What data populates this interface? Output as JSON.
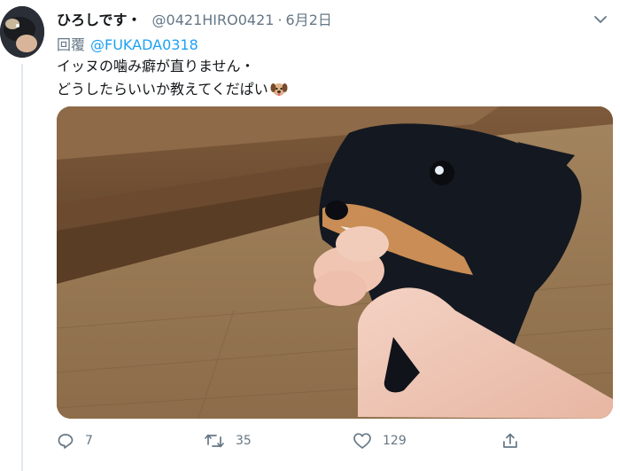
{
  "tweet": {
    "display_name": "ひろしです・",
    "handle": "@0421HIRO0421",
    "separator": "·",
    "date": "6月2日",
    "reply_prefix": "回覆",
    "reply_to": "@FUKADA0318",
    "text_line1": "イッヌの噛み癖が直りません・",
    "text_line2": "どうしたらいいか教えてくだぱい",
    "emoji": "dog-face-icon",
    "media_description_icon": "photo-dog-biting-hand"
  },
  "actions": {
    "reply_count": "7",
    "retweet_count": "35",
    "like_count": "129"
  },
  "colors": {
    "accent": "#1da1f2",
    "secondary_text": "#657786",
    "primary_text": "#14171a",
    "divider": "#e1e8ed"
  }
}
